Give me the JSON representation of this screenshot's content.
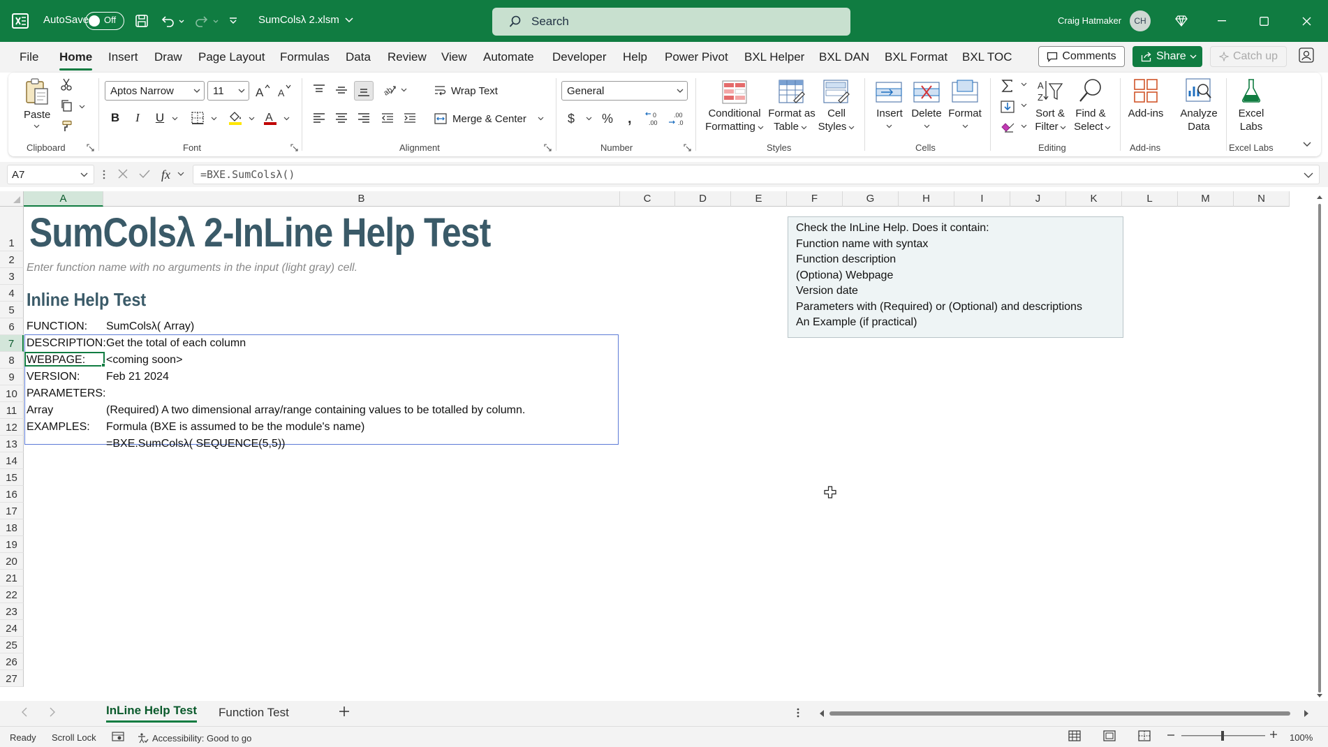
{
  "titlebar": {
    "autosave_label": "AutoSave",
    "autosave_state": "Off",
    "file_name": "SumColsλ 2.xlsm",
    "search_placeholder": "Search",
    "user_name": "Craig Hatmaker",
    "user_initials": "CH"
  },
  "menu": {
    "tabs": [
      "File",
      "Home",
      "Insert",
      "Draw",
      "Page Layout",
      "Formulas",
      "Data",
      "Review",
      "View",
      "Automate",
      "Developer",
      "Help",
      "Power Pivot",
      "BXL Helper",
      "BXL DAN",
      "BXL Format",
      "BXL TOC"
    ],
    "active": "Home",
    "comments": "Comments",
    "share": "Share",
    "catch_up": "Catch up"
  },
  "ribbon": {
    "clipboard": {
      "label": "Clipboard",
      "paste": "Paste"
    },
    "font": {
      "label": "Font",
      "name": "Aptos Narrow",
      "size": "11",
      "bold": "B",
      "italic": "I",
      "underline": "U"
    },
    "alignment": {
      "label": "Alignment",
      "wrap": "Wrap Text",
      "merge": "Merge & Center"
    },
    "number": {
      "label": "Number",
      "format": "General"
    },
    "styles": {
      "label": "Styles",
      "conditional_1": "Conditional",
      "conditional_2": "Formatting",
      "format_table_1": "Format as",
      "format_table_2": "Table",
      "cell_styles_1": "Cell",
      "cell_styles_2": "Styles"
    },
    "cells": {
      "label": "Cells",
      "insert": "Insert",
      "delete": "Delete",
      "format": "Format"
    },
    "editing": {
      "label": "Editing",
      "sort_1": "Sort &",
      "sort_2": "Filter",
      "find_1": "Find &",
      "find_2": "Select"
    },
    "addins": {
      "label": "Add-ins",
      "addins": "Add-ins",
      "analyze_1": "Analyze",
      "analyze_2": "Data"
    },
    "excel_labs": {
      "label": "Excel Labs",
      "labs_1": "Excel",
      "labs_2": "Labs"
    }
  },
  "formula_bar": {
    "name_box": "A7",
    "formula": "=BXE.SumColsλ()"
  },
  "columns": [
    "A",
    "B",
    "C",
    "D",
    "E",
    "F",
    "G",
    "H",
    "I",
    "J",
    "K",
    "L",
    "M",
    "N"
  ],
  "rows": [
    "1",
    "2",
    "3",
    "4",
    "5",
    "6",
    "7",
    "8",
    "9",
    "10",
    "11",
    "12",
    "13",
    "14",
    "15",
    "16",
    "17",
    "18",
    "19",
    "20",
    "21",
    "22",
    "23",
    "24",
    "25",
    "26",
    "27"
  ],
  "sheet": {
    "title": "SumColsλ 2-InLine Help Test",
    "subtitle": "Enter function name with no arguments in the input (light gray) cell.",
    "heading": "Inline Help Test",
    "help_rows": [
      {
        "label": "FUNCTION:",
        "value": "SumColsλ( Array)"
      },
      {
        "label": "DESCRIPTION:",
        "value": "Get the total of each column"
      },
      {
        "label": "WEBPAGE:",
        "value": "<coming soon>"
      },
      {
        "label": "VERSION:",
        "value": "Feb 21 2024"
      },
      {
        "label": "PARAMETERS:",
        "value": ""
      },
      {
        "label": "Array",
        "value": "(Required) A two dimensional array/range containing values to be totalled by column."
      },
      {
        "label": "EXAMPLES:",
        "value": "Formula (BXE is assumed to be the module's name)"
      },
      {
        "label": "",
        "value": "=BXE.SumColsλ( SEQUENCE(5,5))"
      }
    ],
    "note_lines": [
      "Check the InLine Help. Does it contain:",
      "Function name with syntax",
      "Function description",
      "(Optiona) Webpage",
      "Version date",
      "Parameters with (Required) or (Optional) and descriptions",
      "An Example (if practical)"
    ]
  },
  "sheet_tabs": [
    "InLine Help Test",
    "Function Test"
  ],
  "status": {
    "ready": "Ready",
    "scroll_lock": "Scroll Lock",
    "accessibility": "Accessibility: Good to go",
    "zoom": "100%"
  }
}
